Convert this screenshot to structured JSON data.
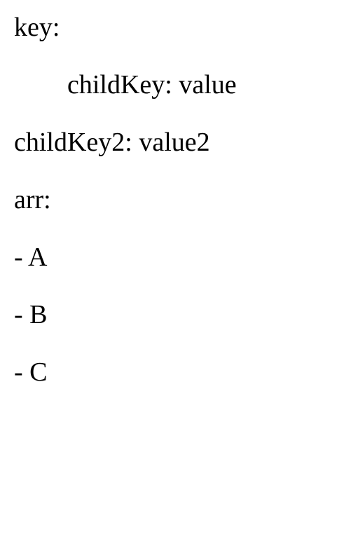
{
  "lines": {
    "l1": "key:",
    "l2": "childKey: value",
    "l3": "childKey2: value2",
    "l4": "arr:",
    "l5": "- A",
    "l6": "- B",
    "l7": "- C"
  }
}
